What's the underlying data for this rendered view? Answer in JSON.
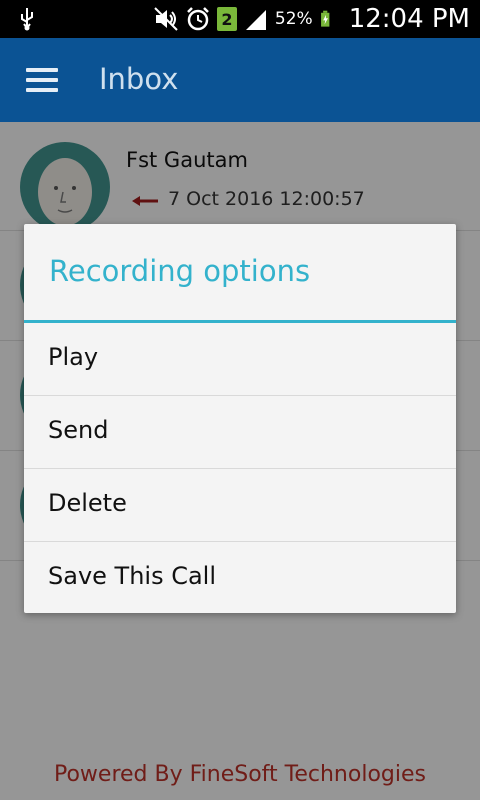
{
  "status_bar": {
    "sim": "2",
    "battery": "52%",
    "time": "12:04 PM"
  },
  "app_bar": {
    "title": "Inbox"
  },
  "inbox": {
    "first_item": {
      "name": "Fst Gautam",
      "datetime": "7 Oct 2016 12:00:57",
      "direction_icon": "incoming-arrow-icon",
      "direction_color": "#9b1c1c"
    }
  },
  "dialog": {
    "title": "Recording options",
    "options": [
      "Play",
      "Send",
      "Delete",
      "Save This Call"
    ],
    "accent_color": "#33b2cc"
  },
  "footer": {
    "text": "Powered By FineSoft Technologies",
    "color": "#b53027"
  }
}
